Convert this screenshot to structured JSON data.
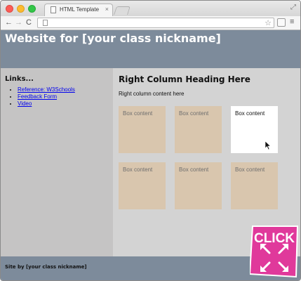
{
  "browser": {
    "tab_title": "HTML Template",
    "tab_close": "×",
    "address": "",
    "back": "←",
    "forward": "→",
    "reload": "C",
    "star": "☆",
    "menu": "≡",
    "fullscreen": "⤢"
  },
  "site": {
    "title": "Website for [your class nickname]",
    "links_heading": "Links...",
    "links": [
      {
        "label": "Reference: W3Schools"
      },
      {
        "label": "Feedback Form"
      },
      {
        "label": "Video"
      }
    ],
    "right_heading": "Right Column Heading Here",
    "right_content": "Right column content here",
    "boxes": [
      {
        "label": "Box content"
      },
      {
        "label": "Box content"
      },
      {
        "label": "Box content"
      },
      {
        "label": "Box content"
      },
      {
        "label": "Box content"
      },
      {
        "label": "Box content"
      }
    ],
    "footer": "Site by [your class nickname]"
  },
  "badge": {
    "text": "CLICK",
    "color": "#e0399b"
  },
  "colors": {
    "header": "#7d8b9b",
    "box": "#d9c6ae",
    "left_column": "#c5c4c4",
    "right_column": "#d3d3d3"
  }
}
